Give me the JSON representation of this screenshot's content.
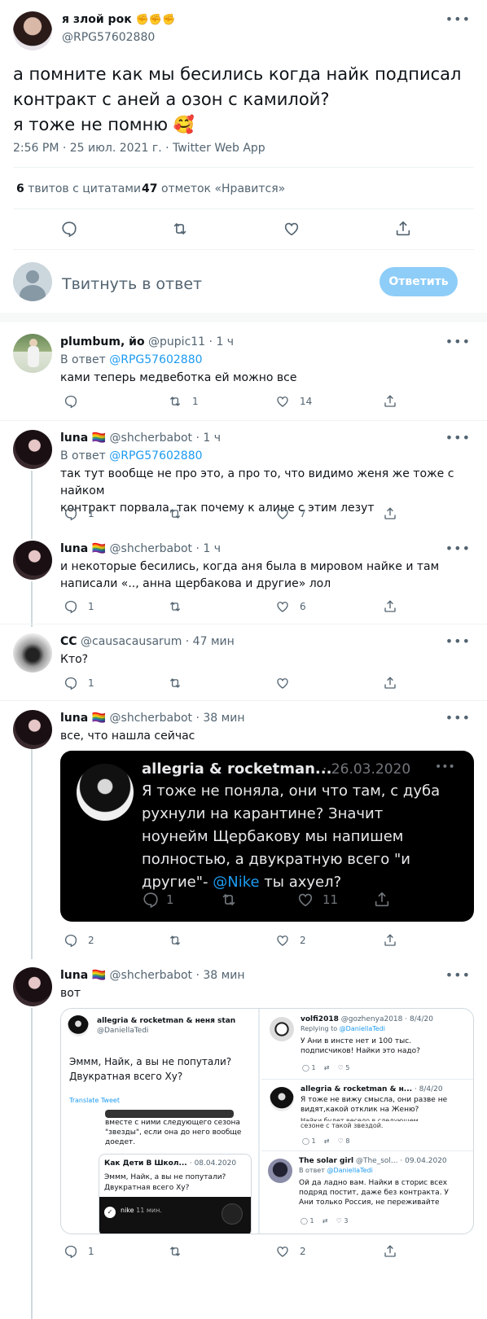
{
  "main_tweet": {
    "name": "я злой рок",
    "emojis": "✊✊✊",
    "handle": "@RPG57602880",
    "text_lines": [
      "а помните как мы бесились когда найк подписал",
      "контракт с аней а озон с камилой?",
      "я тоже не помню"
    ],
    "emoji_end": "🥰",
    "meta": "2:56 PM · 25 июл. 2021 г. · Twitter Web App",
    "quotes_count": "6",
    "quotes_label": "твитов с цитатами",
    "likes_count": "47",
    "likes_label": "отметок «Нравится»"
  },
  "reply_box": {
    "placeholder": "Твитнуть в ответ",
    "button": "Ответить"
  },
  "replies": [
    {
      "name": "plumbum, йо",
      "handle": "@pupic11",
      "time": "· 1 ч",
      "reply_to_label": "В ответ",
      "reply_to": "@RPG57602880",
      "text": "ками теперь медвеботка ей можно все",
      "reply_count": "",
      "retweet_count": "1",
      "like_count": "14"
    },
    {
      "name": "luna",
      "flag": "🏳️‍🌈",
      "handle": "@shcherbabot",
      "time": "· 1 ч",
      "reply_to_label": "В ответ",
      "reply_to": "@RPG57602880",
      "text_lines": [
        "так тут вообще не про это, а про то, что видимо женя же тоже с найком",
        "контракт порвала, так почему к алине с этим лезут"
      ],
      "reply_count": "1",
      "retweet_count": "",
      "like_count": "7"
    },
    {
      "name": "luna",
      "flag": "🏳️‍🌈",
      "handle": "@shcherbabot",
      "time": "· 1 ч",
      "text_lines": [
        "и некоторые бесились, когда аня была в мировом найке и там",
        "написали «.., анна щербакова и другие» лол"
      ],
      "reply_count": "1",
      "retweet_count": "",
      "like_count": "6"
    },
    {
      "name": "CC",
      "handle": "@causacausarum",
      "time": "· 47 мин",
      "text": "Кто?",
      "reply_count": "1",
      "retweet_count": "",
      "like_count": ""
    },
    {
      "name": "luna",
      "flag": "🏳️‍🌈",
      "handle": "@shcherbabot",
      "time": "· 38 мин",
      "text": "все, что нашла сейчас",
      "reply_count": "2",
      "retweet_count": "",
      "like_count": "2",
      "embedded": {
        "name": "allegria & rocketman...",
        "date": "· 26.03.2020",
        "text_lines": [
          "Я тоже не поняла, они что там, с дуба",
          "рухнули на карантине? Значит",
          "ноунейм Щербакову мы напишем",
          "полностью, а двукратную всего \"и"
        ],
        "text_last_pre": "другие\"- ",
        "mention": "@Nike",
        "text_last_post": " ты ахуел?",
        "reply_count": "1",
        "like_count": "11"
      }
    },
    {
      "name": "luna",
      "flag": "🏳️‍🌈",
      "handle": "@shcherbabot",
      "time": "· 38 мин",
      "text": "вот",
      "reply_count": "1",
      "retweet_count": "",
      "like_count": "2",
      "collage": {
        "left": {
          "name": "allegria & rocketman & неня stan",
          "handle": "@DaniellaTedi",
          "text_lines": [
            "Эммм, Найк, а вы не попутали?",
            "Двукратная всего Ху?"
          ],
          "translate": "Translate Tweet",
          "snippet_lines": [
            "вместе с ними следующего сезона",
            "\"звезды\", если она до него вообще",
            "доедет."
          ],
          "quote_name": "Как Дети В Школ...",
          "quote_date": "· 08.04.2020",
          "quote_lines": [
            "Эммм, Найк, а вы не попутали?",
            "Двукратная всего Ху?"
          ],
          "nike_label": "nike",
          "nike_time": "11 мин."
        },
        "right_top": {
          "name": "volfi2018",
          "handle": "@gozhenya2018",
          "date": "· 8/4/20",
          "replying_label": "Replying to",
          "replying": "@DaniellaTedi",
          "text_lines": [
            "У Ани в инсте нет и 100 тыс.",
            "подписчиков! Найки это надо?"
          ],
          "c1": "1",
          "c2": "5"
        },
        "right_mid": {
          "name": "allegria & rocketman & н...",
          "date": "· 8/4/20",
          "text_lines": [
            "Я тоже не вижу смысла, они разве не",
            "видят,какой отклик на Женю?"
          ],
          "snippet": "Найки будет  весело  в следующем",
          "snippet2": "сезоне с такой звездой.",
          "c1": "1",
          "c2": "8"
        },
        "right_bot": {
          "name": "The solar girl",
          "handle": "@The_sol...",
          "date": "· 09.04.2020",
          "reply_label": "В ответ",
          "reply_to": "@DaniellaTedi",
          "text_lines": [
            "Ой да ладно вам. Найки в сторис всех",
            "подряд постит, даже без контракта. У",
            "Ани только Россия, не переживайте"
          ],
          "c1": "1",
          "c2": "3"
        }
      }
    }
  ]
}
